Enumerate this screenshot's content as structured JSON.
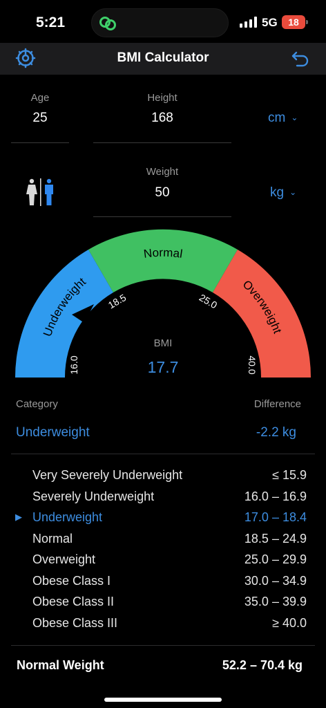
{
  "status": {
    "time": "5:21",
    "network": "5G",
    "battery": "18"
  },
  "nav": {
    "title": "BMI Calculator",
    "settings_icon": "gear-icon",
    "back_icon": "undo-arrow-icon"
  },
  "inputs": {
    "age": {
      "label": "Age",
      "value": "25"
    },
    "height": {
      "label": "Height",
      "value": "168",
      "unit": "cm"
    },
    "weight": {
      "label": "Weight",
      "value": "50",
      "unit": "kg"
    }
  },
  "gauge": {
    "segments": [
      {
        "label": "Underweight",
        "color": "#2f9bef"
      },
      {
        "label": "Normal",
        "color": "#40c062"
      },
      {
        "label": "Overweight",
        "color": "#f15a4a"
      }
    ],
    "ticks": [
      "16.0",
      "18.5",
      "25.0",
      "40.0"
    ],
    "bmi_label": "BMI",
    "bmi_value": "17.7"
  },
  "result": {
    "category_label": "Category",
    "category_value": "Underweight",
    "difference_label": "Difference",
    "difference_value": "-2.2 kg"
  },
  "table": [
    {
      "name": "Very Severely Underweight",
      "range": "≤ 15.9",
      "active": false
    },
    {
      "name": "Severely Underweight",
      "range": "16.0 – 16.9",
      "active": false
    },
    {
      "name": "Underweight",
      "range": "17.0 – 18.4",
      "active": true
    },
    {
      "name": "Normal",
      "range": "18.5 – 24.9",
      "active": false
    },
    {
      "name": "Overweight",
      "range": "25.0 – 29.9",
      "active": false
    },
    {
      "name": "Obese Class I",
      "range": "30.0 – 34.9",
      "active": false
    },
    {
      "name": "Obese Class II",
      "range": "35.0 – 39.9",
      "active": false
    },
    {
      "name": "Obese Class III",
      "range": "≥ 40.0",
      "active": false
    }
  ],
  "footer": {
    "label": "Normal Weight",
    "range": "52.2 – 70.4 kg"
  },
  "colors": {
    "accent": "#3d8de0",
    "background": "#000000"
  }
}
